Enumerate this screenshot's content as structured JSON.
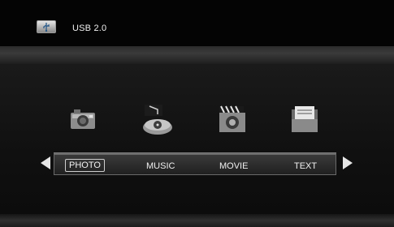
{
  "header": {
    "title": "USB 2.0",
    "icon": "usb-icon"
  },
  "menu": {
    "items": [
      {
        "label": "PHOTO",
        "icon": "camera-icon",
        "selected": true
      },
      {
        "label": "MUSIC",
        "icon": "music-player-icon",
        "selected": false
      },
      {
        "label": "MOVIE",
        "icon": "movie-camera-icon",
        "selected": false
      },
      {
        "label": "TEXT",
        "icon": "document-folder-icon",
        "selected": false
      }
    ],
    "left_arrow": "left-arrow-icon",
    "right_arrow": "right-arrow-icon"
  },
  "colors": {
    "background": "#050505",
    "text": "#f0f0f0",
    "highlight_border": "#cfcfcf"
  }
}
